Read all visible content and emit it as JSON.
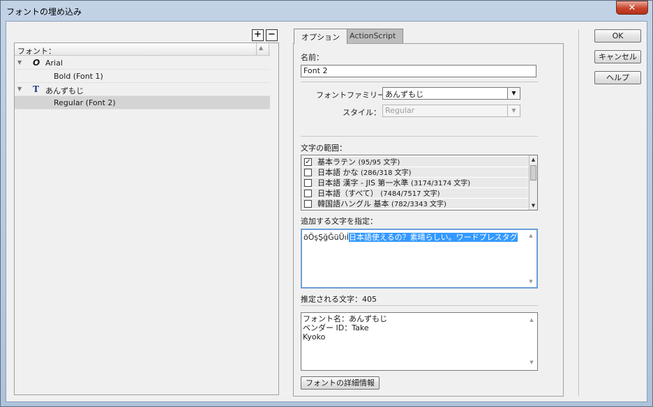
{
  "window": {
    "title": "フォントの埋め込み",
    "close_label": "✕"
  },
  "left": {
    "add_label": "+",
    "remove_label": "−",
    "header": "フォント：",
    "tree": [
      {
        "name": "Arial",
        "icon": "opentype-icon",
        "children": [
          "Bold (Font 1)"
        ]
      },
      {
        "name": "あんずもじ",
        "icon": "truetype-icon",
        "children": [
          "Regular (Font 2)"
        ]
      }
    ]
  },
  "tabs": [
    "オプション",
    "ActionScript"
  ],
  "options": {
    "name_label": "名前：",
    "name_value": "Font 2",
    "family_label": "フォントファミリー：",
    "family_value": "あんずもじ",
    "style_label": "スタイル：",
    "style_value": "Regular",
    "range_label": "文字の範囲：",
    "ranges": [
      {
        "checked": true,
        "label": "基本ラテン",
        "count": "(95/95 文字)"
      },
      {
        "checked": false,
        "label": "日本語 かな",
        "count": "(286/318 文字)"
      },
      {
        "checked": false,
        "label": "日本語 漢字 - JIS 第一水準",
        "count": "(3174/3174 文字)"
      },
      {
        "checked": false,
        "label": "日本語（すべて）",
        "count": "(7484/7517 文字)"
      },
      {
        "checked": false,
        "label": "韓国語ハングル 基本",
        "count": "(782/3343 文字)"
      }
    ],
    "add_chars_label": "追加する文字を指定：",
    "add_chars_plain": "öÖşŞğĞüÜıİ",
    "add_chars_selected": "日本語使えるの？素晴らしい。ワードプレスタグ",
    "estimated_label": "推定される文字：405",
    "info_lines": [
      "フォント名：あんずもじ",
      "ベンダー ID：Take",
      "Kyoko"
    ],
    "details_button": "フォントの詳細情報"
  },
  "buttons": {
    "ok": "OK",
    "cancel": "キャンセル",
    "help": "ヘルプ"
  }
}
